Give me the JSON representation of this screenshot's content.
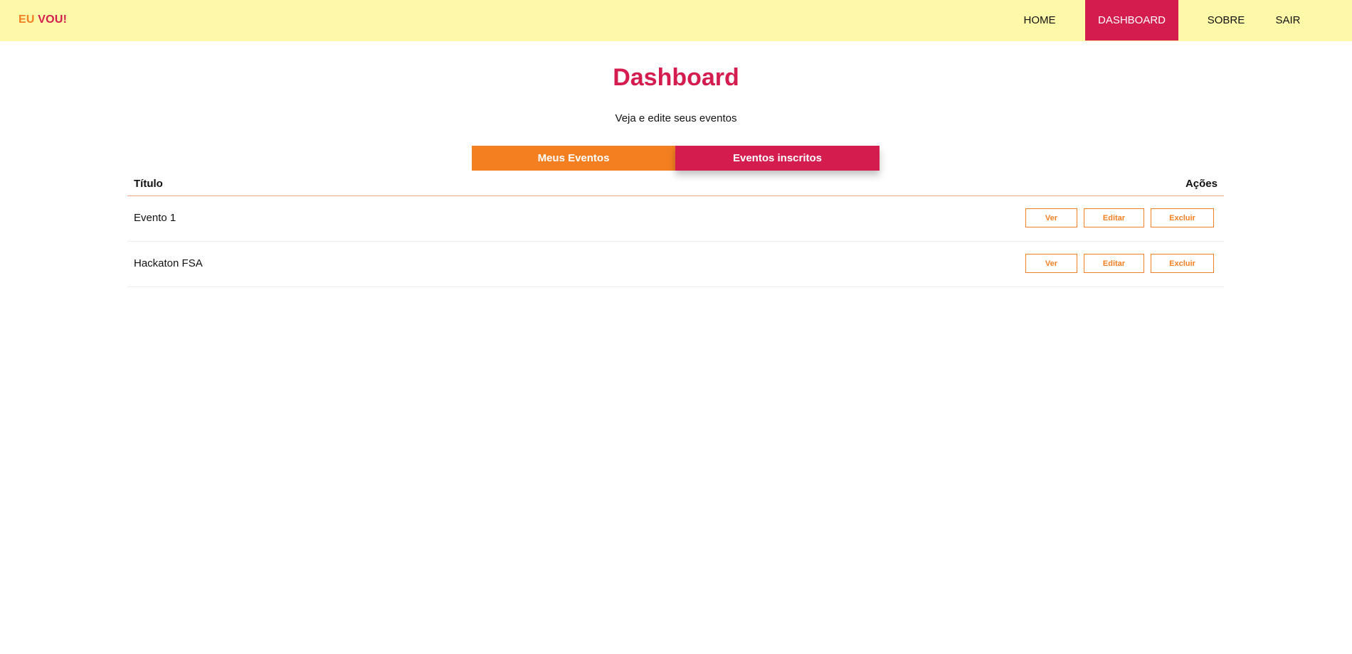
{
  "header": {
    "logo_part1": "EU",
    "logo_part2": "VOU!",
    "nav": [
      {
        "label": "HOME",
        "active": false
      },
      {
        "label": "DASHBOARD",
        "active": true
      },
      {
        "label": "SOBRE",
        "active": false
      },
      {
        "label": "SAIR",
        "active": false
      }
    ]
  },
  "main": {
    "title": "Dashboard",
    "subtitle": "Veja e edite seus eventos",
    "tabs": [
      {
        "label": "Meus Eventos"
      },
      {
        "label": "Eventos inscritos"
      }
    ],
    "table": {
      "columns": [
        "Título",
        "Ações"
      ],
      "rows": [
        {
          "title": "Evento 1",
          "actions": [
            "Ver",
            "Editar",
            "Excluir"
          ]
        },
        {
          "title": "Hackaton FSA",
          "actions": [
            "Ver",
            "Editar",
            "Excluir"
          ]
        }
      ]
    }
  },
  "colors": {
    "header_bg": "#fef9a8",
    "accent_orange": "#f47f21",
    "accent_red": "#d41c4f"
  }
}
